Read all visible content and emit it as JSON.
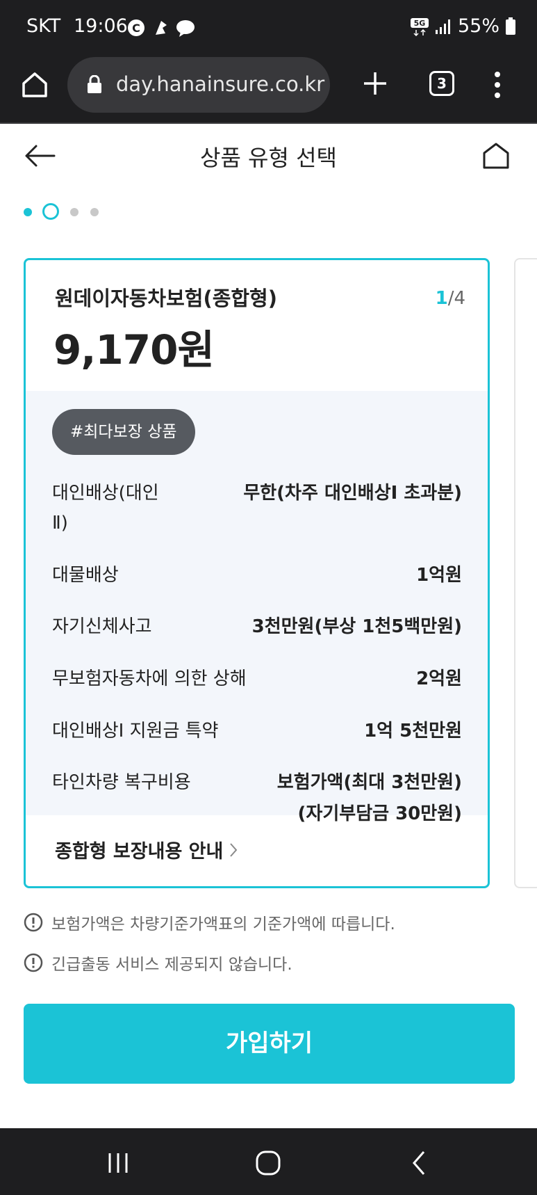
{
  "status_bar": {
    "carrier": "SKT",
    "time": "19:06",
    "network": "5G",
    "battery": "55%"
  },
  "browser": {
    "url": "day.hanainsure.co.kr",
    "tab_count": "3"
  },
  "header": {
    "title": "상품 유형 선택"
  },
  "pager": {
    "total": 4,
    "active_index": 1
  },
  "card": {
    "title": "원데이자동차보험(종합형)",
    "page_current": "1",
    "page_total": "/4",
    "price": "9,170원",
    "tag": "#최다보장 상품",
    "rows": [
      {
        "label": "대인배상(대인",
        "label2": "Ⅱ)",
        "value": "무한(차주 대인배상Ⅰ 초과분)"
      },
      {
        "label": "대물배상",
        "value": "1억원"
      },
      {
        "label": "자기신체사고",
        "value": "3천만원(부상 1천5백만원)"
      },
      {
        "label": "무보험자동차에 의한 상해",
        "value": "2억원"
      },
      {
        "label": "대인배상Ⅰ 지원금 특약",
        "value": "1억 5천만원"
      },
      {
        "label": "타인차량 복구비용",
        "value": "보험가액(최대 3천만원)",
        "value2": "(자기부담금 30만원)"
      }
    ],
    "footer_link": "종합형 보장내용 안내"
  },
  "notices": [
    "보험가액은 차량기준가액표의 기준가액에 따릅니다.",
    "긴급출동 서비스 제공되지 않습니다."
  ],
  "cta": {
    "label": "가입하기"
  },
  "colors": {
    "accent": "#1bc3d6",
    "badge": "#565a60",
    "card_body_bg": "#f3f6fb",
    "system_bar": "#1e1e20"
  },
  "icons": [
    "home-icon",
    "lock-icon",
    "plus-icon",
    "more-vert-icon",
    "back-arrow-icon",
    "chevron-right-icon",
    "info-circle-icon",
    "recent-apps-icon",
    "home-nav-icon",
    "back-nav-icon"
  ]
}
